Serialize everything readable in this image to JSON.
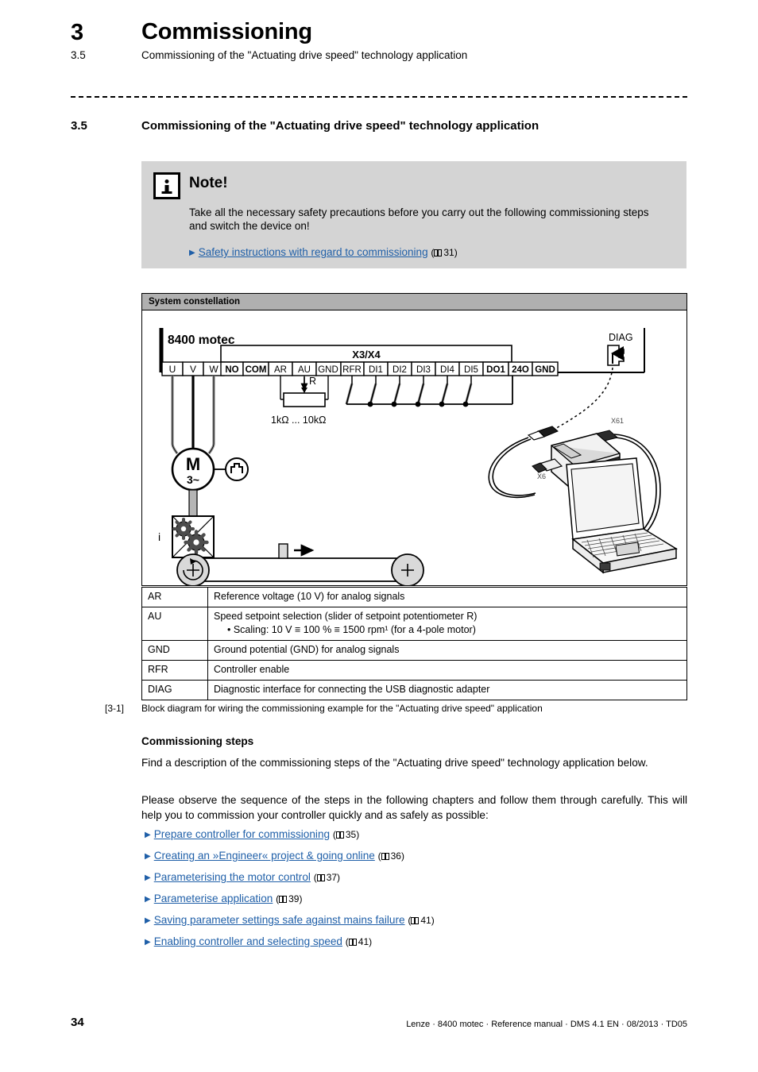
{
  "header": {
    "chapter_number": "3",
    "chapter_title": "Commissioning",
    "section_number": "3.5",
    "section_title": "Commissioning of the \"Actuating drive speed\" technology application"
  },
  "section": {
    "number": "3.5",
    "title": "Commissioning of the \"Actuating drive speed\" technology application"
  },
  "note": {
    "title": "Note!",
    "body": "Take all the necessary safety precautions before you carry out the following commissioning steps and switch the device on!",
    "link_text": "Safety instructions with regard to commissioning",
    "link_page": "31"
  },
  "figure": {
    "bar_title": "System constellation",
    "device_label": "8400 motec",
    "diag_label": "DIAG",
    "connector_group_label": "X3/X4",
    "motor_terminals": [
      "U",
      "V",
      "W"
    ],
    "io_terminals": [
      "NO",
      "COM",
      "AR",
      "AU",
      "GND",
      "RFR",
      "DI1",
      "DI2",
      "DI3",
      "DI4",
      "DI5",
      "DO1",
      "24O",
      "GND"
    ],
    "pot_label": "R",
    "pot_value": "1kΩ ... 10kΩ",
    "motor_label": "M",
    "motor_phases": "3~",
    "gearbox_label": "i",
    "adapter_port_top": "X61",
    "adapter_port_bottom": "X6",
    "number": "[3-1]",
    "caption": "Block diagram for wiring the commissioning example for the \"Actuating drive speed\" application"
  },
  "legend": {
    "rows": [
      {
        "key": "AR",
        "desc": "Reference voltage (10 V) for analog signals",
        "sub": ""
      },
      {
        "key": "AU",
        "desc": "Speed setpoint selection (slider of setpoint potentiometer R)",
        "sub": "• Scaling: 10 V ≡ 100 % ≡ 1500 rpm¹ (for a 4-pole motor)"
      },
      {
        "key": "GND",
        "desc": "Ground potential (GND) for analog signals",
        "sub": ""
      },
      {
        "key": "RFR",
        "desc": "Controller enable",
        "sub": ""
      },
      {
        "key": "DIAG",
        "desc": "Diagnostic interface for connecting the USB diagnostic adapter",
        "sub": ""
      }
    ]
  },
  "body": {
    "steps_heading": "Commissioning steps",
    "paragraph_1": "Find a description of the commissioning steps of the \"Actuating drive speed\" technology application below.",
    "paragraph_2": "Please observe the sequence of the steps in the following chapters and follow them through carefully. This will help you to commission your controller quickly and as safely as possible:"
  },
  "links": [
    {
      "text": "Prepare controller for commissioning",
      "page": "35"
    },
    {
      "text": "Creating an »Engineer« project & going online",
      "page": "36"
    },
    {
      "text": "Parameterising the motor control",
      "page": "37"
    },
    {
      "text": "Parameterise application",
      "page": "39"
    },
    {
      "text": "Saving parameter settings safe against mains failure",
      "page": "41"
    },
    {
      "text": "Enabling controller and selecting speed",
      "page": "41"
    }
  ],
  "footer": {
    "page_number": "34",
    "doc_info": "Lenze · 8400 motec · Reference manual · DMS 4.1 EN · 08/2013 · TD05"
  },
  "colors": {
    "link": "#1f5fa8",
    "note_bg": "#d4d4d4",
    "figure_bar_bg": "#b0b0b0"
  }
}
